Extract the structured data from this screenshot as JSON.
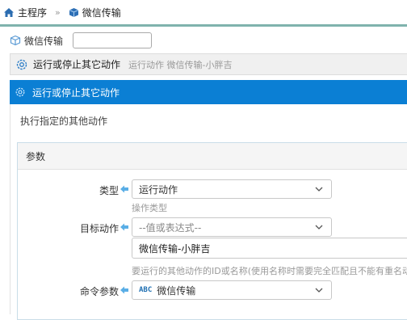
{
  "breadcrumb": {
    "home_label": "主程序",
    "separator": "»",
    "current_label": "微信传输"
  },
  "name_row": {
    "label": "微信传输",
    "input_value": ""
  },
  "action_row": {
    "title": "运行或停止其它动作",
    "subtitle": "运行动作 微信传输-小胖吉"
  },
  "panel": {
    "header_title": "运行或停止其它动作",
    "description": "执行指定的其他动作",
    "params_title": "参数",
    "fields": {
      "type": {
        "label": "类型",
        "value": "运行动作",
        "hint": "操作类型"
      },
      "target": {
        "label": "目标动作",
        "placeholder": "--值或表达式--",
        "value": "微信传输-小胖吉",
        "hint": "要运行的其他动作的ID或名称(使用名称时需要完全匹配且不能有重名动"
      },
      "command": {
        "label": "命令参数",
        "badge": "ABC",
        "value": "微信传输"
      }
    }
  },
  "colors": {
    "header_blue": "#0b7fd4",
    "accent_teal": "#7fb3ad",
    "arrow_blue": "#5aaee6"
  }
}
